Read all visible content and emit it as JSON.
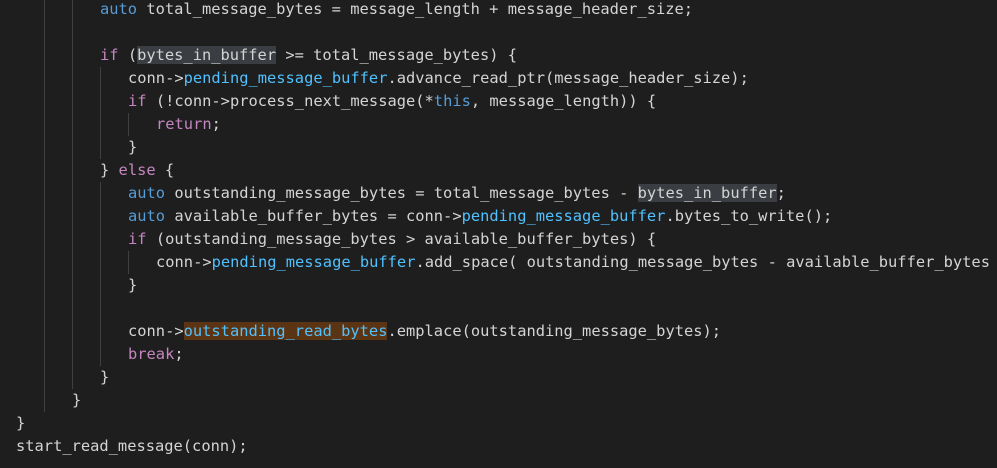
{
  "editor": {
    "colors": {
      "background": "#1e1e1e",
      "keyword": "#569cd6",
      "control": "#c586c0",
      "identifier": "#d4d4d4",
      "member": "#4fc1ff",
      "function": "#dcdcaa",
      "highlight_read": "#3a3d41",
      "highlight_write": "#5b3513"
    },
    "lines": [
      {
        "indent": 3,
        "tokens": [
          {
            "t": "auto",
            "c": "kw"
          },
          {
            "t": " total_message_bytes = message_length + message_header_size;",
            "c": "id"
          }
        ]
      },
      {
        "indent": 0,
        "tokens": []
      },
      {
        "indent": 3,
        "tokens": [
          {
            "t": "if",
            "c": "ctl"
          },
          {
            "t": " (",
            "c": "id"
          },
          {
            "t": "bytes_in_buffer",
            "c": "id",
            "hl": "read"
          },
          {
            "t": " >= total_message_bytes) {",
            "c": "id"
          }
        ]
      },
      {
        "indent": 4,
        "tokens": [
          {
            "t": "conn->",
            "c": "id"
          },
          {
            "t": "pending_message_buffer",
            "c": "mem"
          },
          {
            "t": ".advance_read_ptr(message_header_size);",
            "c": "id"
          }
        ]
      },
      {
        "indent": 4,
        "tokens": [
          {
            "t": "if",
            "c": "ctl"
          },
          {
            "t": " (!conn->process_next_message(*",
            "c": "id"
          },
          {
            "t": "this",
            "c": "kw"
          },
          {
            "t": ", message_length)) {",
            "c": "id"
          }
        ]
      },
      {
        "indent": 5,
        "tokens": [
          {
            "t": "return",
            "c": "ctl"
          },
          {
            "t": ";",
            "c": "id"
          }
        ]
      },
      {
        "indent": 4,
        "tokens": [
          {
            "t": "}",
            "c": "id"
          }
        ]
      },
      {
        "indent": 3,
        "tokens": [
          {
            "t": "} ",
            "c": "id"
          },
          {
            "t": "else",
            "c": "ctl"
          },
          {
            "t": " {",
            "c": "id"
          }
        ]
      },
      {
        "indent": 4,
        "tokens": [
          {
            "t": "auto",
            "c": "kw"
          },
          {
            "t": " outstanding_message_bytes = total_message_bytes - ",
            "c": "id"
          },
          {
            "t": "bytes_in_buffer",
            "c": "id",
            "hl": "read"
          },
          {
            "t": ";",
            "c": "id"
          }
        ]
      },
      {
        "indent": 4,
        "tokens": [
          {
            "t": "auto",
            "c": "kw"
          },
          {
            "t": " available_buffer_bytes = conn->",
            "c": "id"
          },
          {
            "t": "pending_message_buffer",
            "c": "mem"
          },
          {
            "t": ".bytes_to_write();",
            "c": "id"
          }
        ]
      },
      {
        "indent": 4,
        "tokens": [
          {
            "t": "if",
            "c": "ctl"
          },
          {
            "t": " (outstanding_message_bytes > available_buffer_bytes) {",
            "c": "id"
          }
        ]
      },
      {
        "indent": 5,
        "tokens": [
          {
            "t": "conn->",
            "c": "id"
          },
          {
            "t": "pending_message_buffer",
            "c": "mem"
          },
          {
            "t": ".add_space( outstanding_message_bytes - available_buffer_bytes );",
            "c": "id"
          }
        ]
      },
      {
        "indent": 4,
        "tokens": [
          {
            "t": "}",
            "c": "id"
          }
        ]
      },
      {
        "indent": 0,
        "tokens": []
      },
      {
        "indent": 4,
        "tokens": [
          {
            "t": "conn->",
            "c": "id"
          },
          {
            "t": "outstanding_read_bytes",
            "c": "mem",
            "hl": "write"
          },
          {
            "t": ".emplace(outstanding_message_bytes);",
            "c": "id"
          }
        ]
      },
      {
        "indent": 4,
        "tokens": [
          {
            "t": "break",
            "c": "ctl"
          },
          {
            "t": ";",
            "c": "id"
          }
        ]
      },
      {
        "indent": 3,
        "tokens": [
          {
            "t": "}",
            "c": "id"
          }
        ]
      },
      {
        "indent": 2,
        "tokens": [
          {
            "t": "}",
            "c": "id"
          }
        ]
      },
      {
        "indent": 0,
        "tokens": [
          {
            "t": "}",
            "c": "id"
          }
        ]
      },
      {
        "indent": 0,
        "tokens": [
          {
            "t": "start_read_message(conn);",
            "c": "id"
          }
        ]
      }
    ]
  }
}
